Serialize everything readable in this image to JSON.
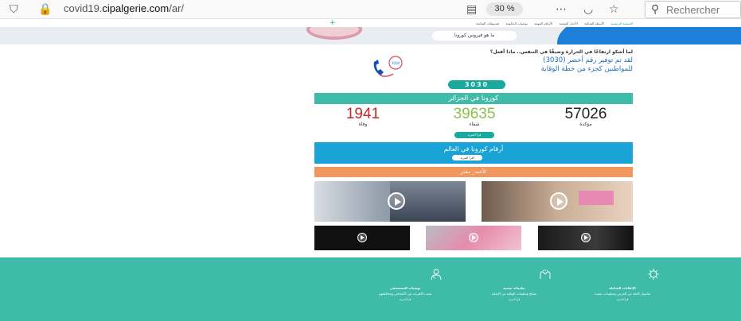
{
  "browser": {
    "url_prefix": "covid19.",
    "url_domain": "cipalgerie.com",
    "url_path": "/ar/",
    "zoom": "30 %",
    "search_placeholder": "Rechercher"
  },
  "nav": {
    "items": [
      "الصفحة الرئيسية",
      "الأسئلة الشائعة",
      "الأخبار الصحية",
      "الأرقام المهمة",
      "توصيات الحكومة",
      "فيديوهات المتابعة"
    ],
    "plus": "+"
  },
  "hero": {
    "button": "ما هو فيروس كورونا"
  },
  "info": {
    "question": "لما أشكو ارتفاعًا في الحرارة وضيقًا في التنفس.. ماذا أفعل؟",
    "green_line1": "لقد تم توفير رقم أخضر (3030)",
    "green_line2": "للمواطنين كجزء من خطة الوقاية",
    "badge": "3030"
  },
  "algeria": {
    "title": "كورونا في الجزائر",
    "stats": [
      {
        "value": "57026",
        "label": "مؤكدة",
        "color": "#222222"
      },
      {
        "value": "39635",
        "label": "شفاء",
        "color": "#8bc34a"
      },
      {
        "value": "1941",
        "label": "وفاة",
        "color": "#c62828"
      }
    ],
    "more": "قرأ المزيد"
  },
  "world": {
    "title": "أرقام كورونا في العالم",
    "more": "اقرأ المزيد"
  },
  "orange": {
    "label": "الأعمد_ مقدر"
  },
  "videos": {
    "large": [
      {
        "caption": "",
        "bg": "#8a95a3"
      },
      {
        "caption": "",
        "bg": "#b59b85"
      }
    ],
    "small": [
      {
        "caption": "",
        "bg": "#1b1b1b"
      },
      {
        "caption": "",
        "bg": "#e28aa8"
      },
      {
        "caption": "",
        "bg": "#2a2a2a"
      }
    ]
  },
  "footer": {
    "columns": [
      {
        "icon": "virus-icon",
        "heading": "الإعلانات الشاملة",
        "text": "تفاصيل كاملة عن المرض ومعلومات مفيدة",
        "more": "قرأ المزيد"
      },
      {
        "icon": "hands-icon",
        "heading": "تعليمات صحية",
        "text": "نصائح وتعليمات الوقاية من الإصابة",
        "more": "قرأ المزيد"
      },
      {
        "icon": "doctor-icon",
        "heading": "توصيات المستشفى",
        "text": "تجنب الاقتراب من الأشخاص ومخالطتهم",
        "more": "قرأ المزيد"
      }
    ]
  }
}
